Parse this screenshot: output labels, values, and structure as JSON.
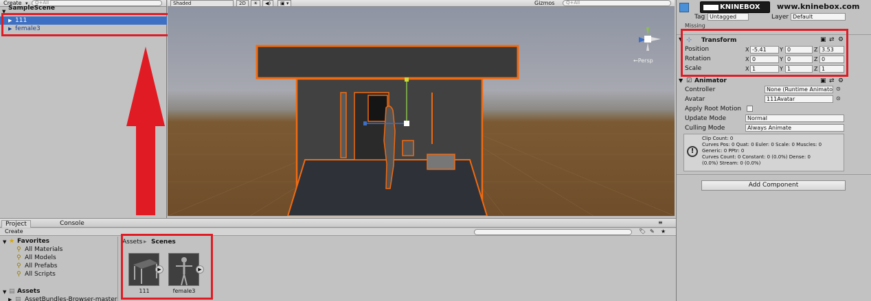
{
  "hierarchy": {
    "create": "Create",
    "search_placeholder": "Q+All",
    "scene": "SampleScene",
    "items": [
      "111",
      "female3"
    ]
  },
  "scene_toolbar": {
    "shading": "Shaded",
    "mode_2d": "2D",
    "gizmos": "Gizmos",
    "search_placeholder": "Q+All",
    "persp": "←Persp"
  },
  "inspector": {
    "tag_label": "Tag",
    "tag_value": "Untagged",
    "layer_label": "Layer",
    "layer_value": "Default",
    "missing": "Missing",
    "transform": {
      "title": "Transform",
      "rows": [
        {
          "label": "Position",
          "x": "-5.41",
          "y": "0",
          "z": "3.53"
        },
        {
          "label": "Rotation",
          "x": "0",
          "y": "0",
          "z": "0"
        },
        {
          "label": "Scale",
          "x": "1",
          "y": "1",
          "z": "1"
        }
      ]
    },
    "animator": {
      "title": "Animator",
      "rows": [
        {
          "label": "Controller",
          "value": "None (Runtime Animator C"
        },
        {
          "label": "Avatar",
          "value": "111Avatar"
        },
        {
          "label": "Apply Root Motion",
          "value": ""
        },
        {
          "label": "Update Mode",
          "value": "Normal"
        },
        {
          "label": "Culling Mode",
          "value": "Always Animate"
        }
      ],
      "info": [
        "Clip Count: 0",
        "Curves Pos: 0 Quat: 0 Euler: 0 Scale: 0 Muscles: 0",
        "Generic: 0 PPtr: 0",
        "Curves Count: 0 Constant: 0 (0.0%) Dense: 0",
        "(0.0%) Stream: 0 (0.0%)"
      ]
    },
    "add_component": "Add Component"
  },
  "project": {
    "tabs": [
      "Project",
      "Console"
    ],
    "create": "Create",
    "favorites_title": "Favorites",
    "favorites": [
      "All Materials",
      "All Models",
      "All Prefabs",
      "All Scripts"
    ],
    "assets_title": "Assets",
    "assets_item": "AssetBundles-Browser-master",
    "breadcrumb_root": "Assets",
    "breadcrumb_current": "Scenes",
    "files": [
      "111",
      "female3"
    ]
  },
  "watermark": {
    "brand": "KNINEBOX",
    "url": "www.kninebox.com"
  },
  "colors": {
    "highlight": "#e01b24",
    "selection": "#3d6fc4",
    "outline": "#f26a10"
  }
}
